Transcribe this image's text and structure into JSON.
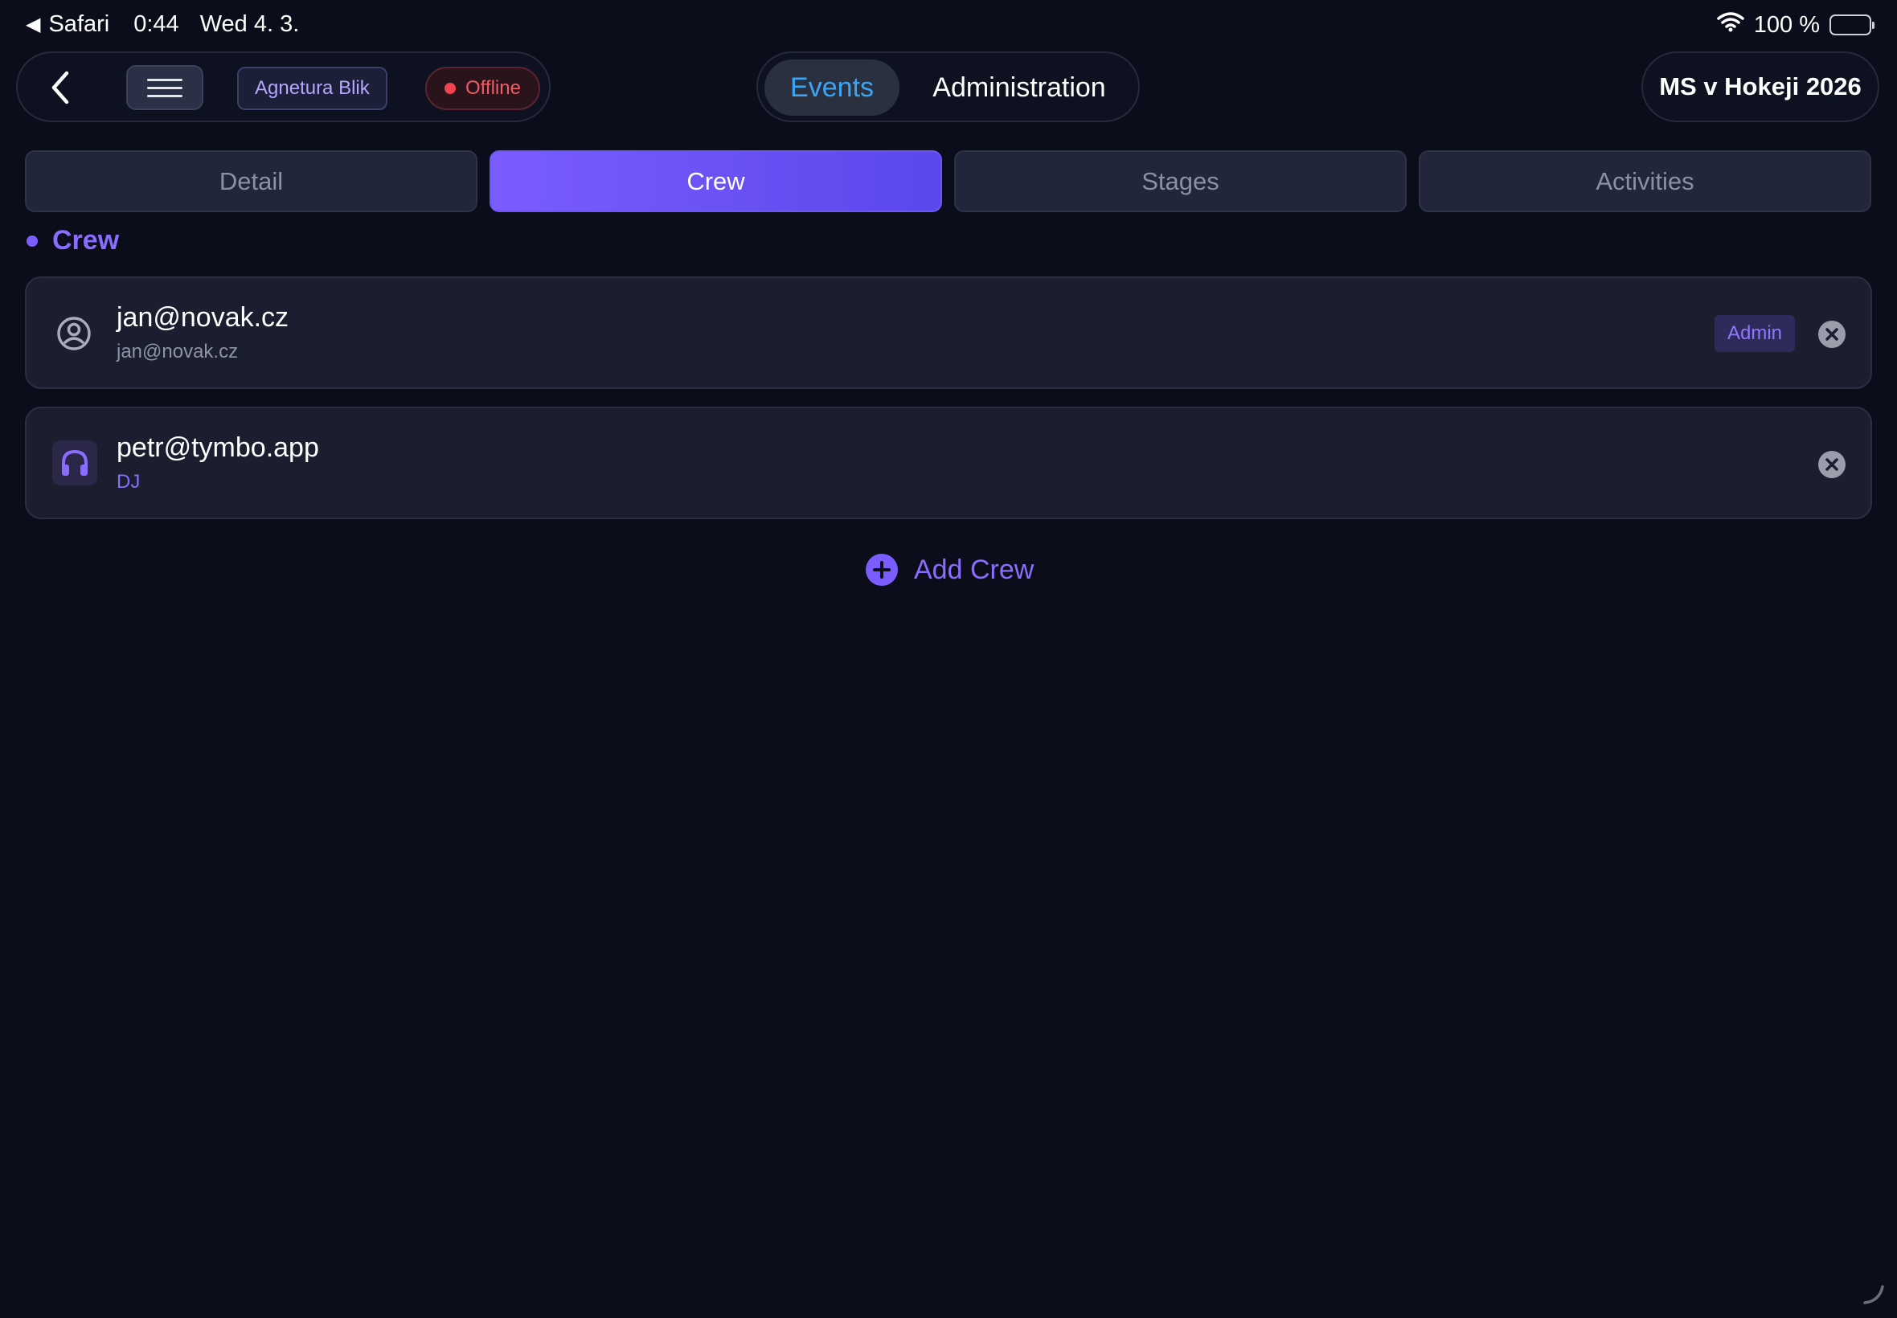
{
  "status_bar": {
    "back_app": "Safari",
    "time": "0:44",
    "date": "Wed 4. 3.",
    "battery": "100 %"
  },
  "header": {
    "org_name": "Agnetura Blik",
    "connection_status": "Offline",
    "nav_events": "Events",
    "nav_administration": "Administration",
    "event_name": "MS v Hokeji 2026"
  },
  "tabs": [
    "Detail",
    "Crew",
    "Stages",
    "Activities"
  ],
  "active_tab": "Crew",
  "section_title": "Crew",
  "crew": [
    {
      "name": "jan@novak.cz",
      "subtitle": "jan@novak.cz",
      "badge": "Admin",
      "icon": "person-circle-icon"
    },
    {
      "name": "petr@tymbo.app",
      "subtitle": "DJ",
      "icon": "headphones-icon"
    }
  ],
  "add_crew_label": "Add Crew",
  "colors": {
    "background": "#0b0e1a",
    "accent": "#7a5cff",
    "events_active": "#3aa5f5",
    "offline": "#f2444f"
  }
}
